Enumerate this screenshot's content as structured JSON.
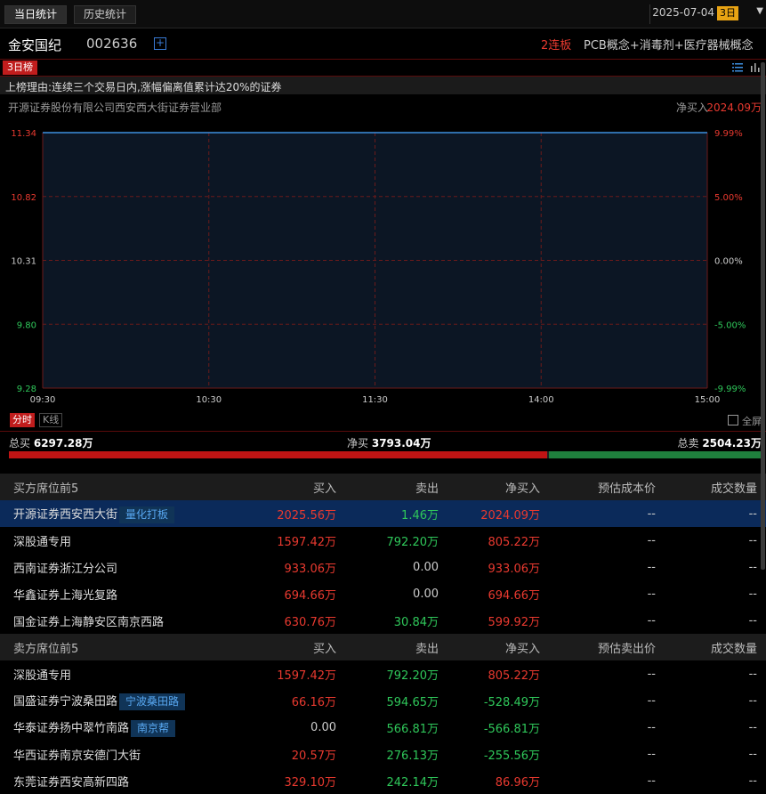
{
  "tabs": [
    "当日统计",
    "历史统计"
  ],
  "date": "2025-07-04",
  "day_pill": "3日",
  "stock": {
    "name": "金安国纪",
    "code": "002636",
    "lianban": "2连板",
    "concepts": "PCB概念+消毒剂+医疗器械概念"
  },
  "rank_badge": "3日榜",
  "reason": "上榜理由:连续三个交易日内,涨幅偏离值累计达20%的证券",
  "broker": "开源证券股份有限公司西安西大街证券营业部",
  "net_buy_label": "净买入",
  "net_buy_value": "2024.09万",
  "chart_data": {
    "type": "line",
    "x_ticks": [
      "09:30",
      "10:30",
      "11:30",
      "14:00",
      "15:00"
    ],
    "y_ticks": [
      "11.34",
      "10.82",
      "10.31",
      "9.80",
      "9.28"
    ],
    "y2_ticks": [
      "9.99%",
      "5.00%",
      "0.00%",
      "-5.00%",
      "-9.99%"
    ],
    "ylim": [
      9.28,
      11.34
    ],
    "series": [
      {
        "x": [
          "09:30",
          "15:00"
        ],
        "values": [
          11.34,
          11.34
        ]
      }
    ],
    "colors": {
      "line": "#3d8fe0",
      "fill": "#0c1624",
      "grid": "#6b1a1a",
      "up": "#e8392f",
      "down": "#2fc75a"
    }
  },
  "chart_tabs": {
    "intraday": "分时",
    "kline": "K线",
    "fullscreen": "全屏"
  },
  "totals": {
    "buy_label": "总买",
    "buy_value": "6297.28万",
    "net_label": "净买",
    "net_value": "3793.04万",
    "sell_label": "总卖",
    "sell_value": "2504.23万",
    "buy_share": 0.7155
  },
  "buy_table": {
    "headers": [
      "买方席位前5",
      "买入",
      "卖出",
      "净买入",
      "预估成本价",
      "成交数量"
    ],
    "rows": [
      {
        "name": "开源证券西安西大街",
        "tag": "量化打板",
        "buy": "2025.56万",
        "sell": "1.46万",
        "net": "2024.09万",
        "price": "--",
        "qty": "--"
      },
      {
        "name": "深股通专用",
        "tag": "",
        "buy": "1597.42万",
        "sell": "792.20万",
        "net": "805.22万",
        "price": "--",
        "qty": "--"
      },
      {
        "name": "西南证券浙江分公司",
        "tag": "",
        "buy": "933.06万",
        "sell": "0.00",
        "net": "933.06万",
        "price": "--",
        "qty": "--"
      },
      {
        "name": "华鑫证券上海光复路",
        "tag": "",
        "buy": "694.66万",
        "sell": "0.00",
        "net": "694.66万",
        "price": "--",
        "qty": "--"
      },
      {
        "name": "国金证券上海静安区南京西路",
        "tag": "",
        "buy": "630.76万",
        "sell": "30.84万",
        "net": "599.92万",
        "price": "--",
        "qty": "--"
      }
    ]
  },
  "sell_table": {
    "headers": [
      "卖方席位前5",
      "买入",
      "卖出",
      "净买入",
      "预估卖出价",
      "成交数量"
    ],
    "rows": [
      {
        "name": "深股通专用",
        "tag": "",
        "buy": "1597.42万",
        "sell": "792.20万",
        "net": "805.22万",
        "price": "--",
        "qty": "--"
      },
      {
        "name": "国盛证券宁波桑田路",
        "tag": "宁波桑田路",
        "buy": "66.16万",
        "sell": "594.65万",
        "net": "-528.49万",
        "price": "--",
        "qty": "--"
      },
      {
        "name": "华泰证券扬中翠竹南路",
        "tag": "南京帮",
        "buy": "0.00",
        "sell": "566.81万",
        "net": "-566.81万",
        "price": "--",
        "qty": "--"
      },
      {
        "name": "华西证券南京安德门大街",
        "tag": "",
        "buy": "20.57万",
        "sell": "276.13万",
        "net": "-255.56万",
        "price": "--",
        "qty": "--"
      },
      {
        "name": "东莞证券西安高新四路",
        "tag": "",
        "buy": "329.10万",
        "sell": "242.14万",
        "net": "86.96万",
        "price": "--",
        "qty": "--"
      }
    ]
  }
}
